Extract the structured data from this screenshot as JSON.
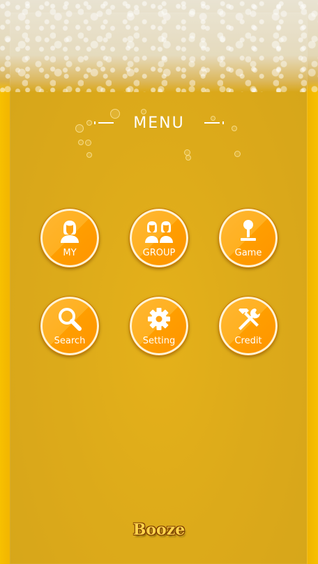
{
  "header": {
    "title": "MENU"
  },
  "menu": {
    "items": [
      {
        "label": "MY",
        "icon": "person-icon"
      },
      {
        "label": "GROUP",
        "icon": "group-icon"
      },
      {
        "label": "Game",
        "icon": "joystick-icon"
      },
      {
        "label": "Search",
        "icon": "search-icon"
      },
      {
        "label": "Setting",
        "icon": "gear-icon"
      },
      {
        "label": "Credit",
        "icon": "tools-icon"
      }
    ]
  },
  "footer": {
    "logo_text": "Booze"
  },
  "colors": {
    "accent": "#ffa20f",
    "beer": "#d9a100",
    "text": "#ffffff"
  }
}
